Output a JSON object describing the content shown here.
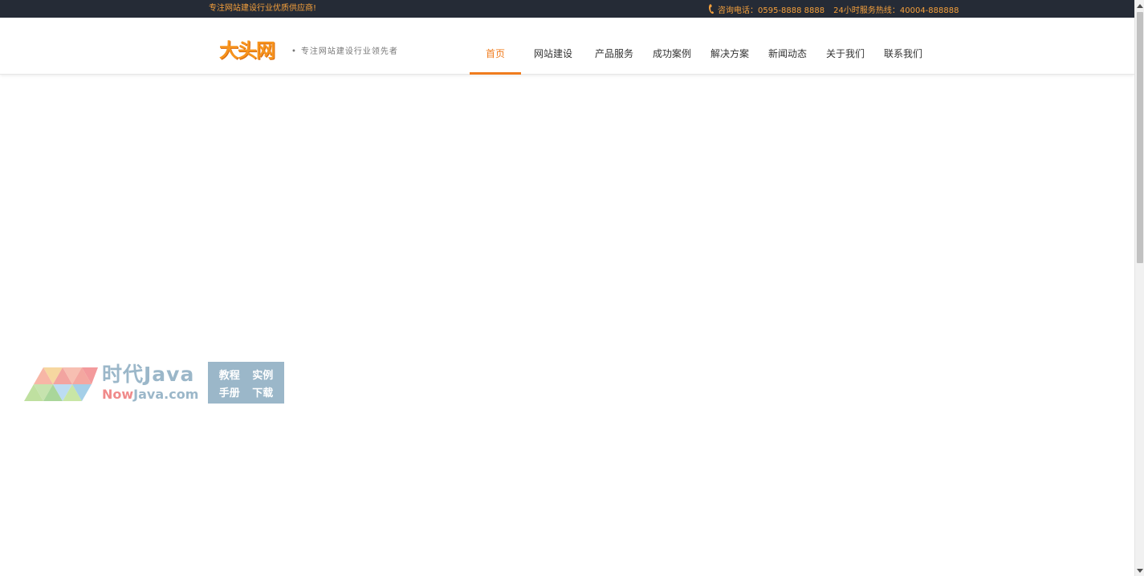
{
  "topbar": {
    "slogan": "专注网站建设行业优质供应商!",
    "phone_label": "咨询电话：0595-8888 8888",
    "hotline_label": "24小时服务热线：40004-888888",
    "accent_color": "#f5a03c",
    "background_color": "#252b36"
  },
  "header": {
    "logo_text": "大头网",
    "tagline": "专注网站建设行业领先者"
  },
  "nav": {
    "active_color": "#f07c1e",
    "items": [
      {
        "label": "首页",
        "active": true
      },
      {
        "label": "网站建设",
        "active": false
      },
      {
        "label": "产品服务",
        "active": false
      },
      {
        "label": "成功案例",
        "active": false
      },
      {
        "label": "解决方案",
        "active": false
      },
      {
        "label": "新闻动态",
        "active": false
      },
      {
        "label": "关于我们",
        "active": false
      },
      {
        "label": "联系我们",
        "active": false
      }
    ]
  },
  "watermark": {
    "title": "时代Java",
    "domain_now": "Now",
    "domain_rest": "Java.com",
    "box": [
      "教程",
      "实例",
      "手册",
      "下载"
    ]
  },
  "icons": {
    "phone": "phone-icon",
    "scroll_up": "chevron-up-icon",
    "scroll_down": "chevron-down-icon"
  }
}
